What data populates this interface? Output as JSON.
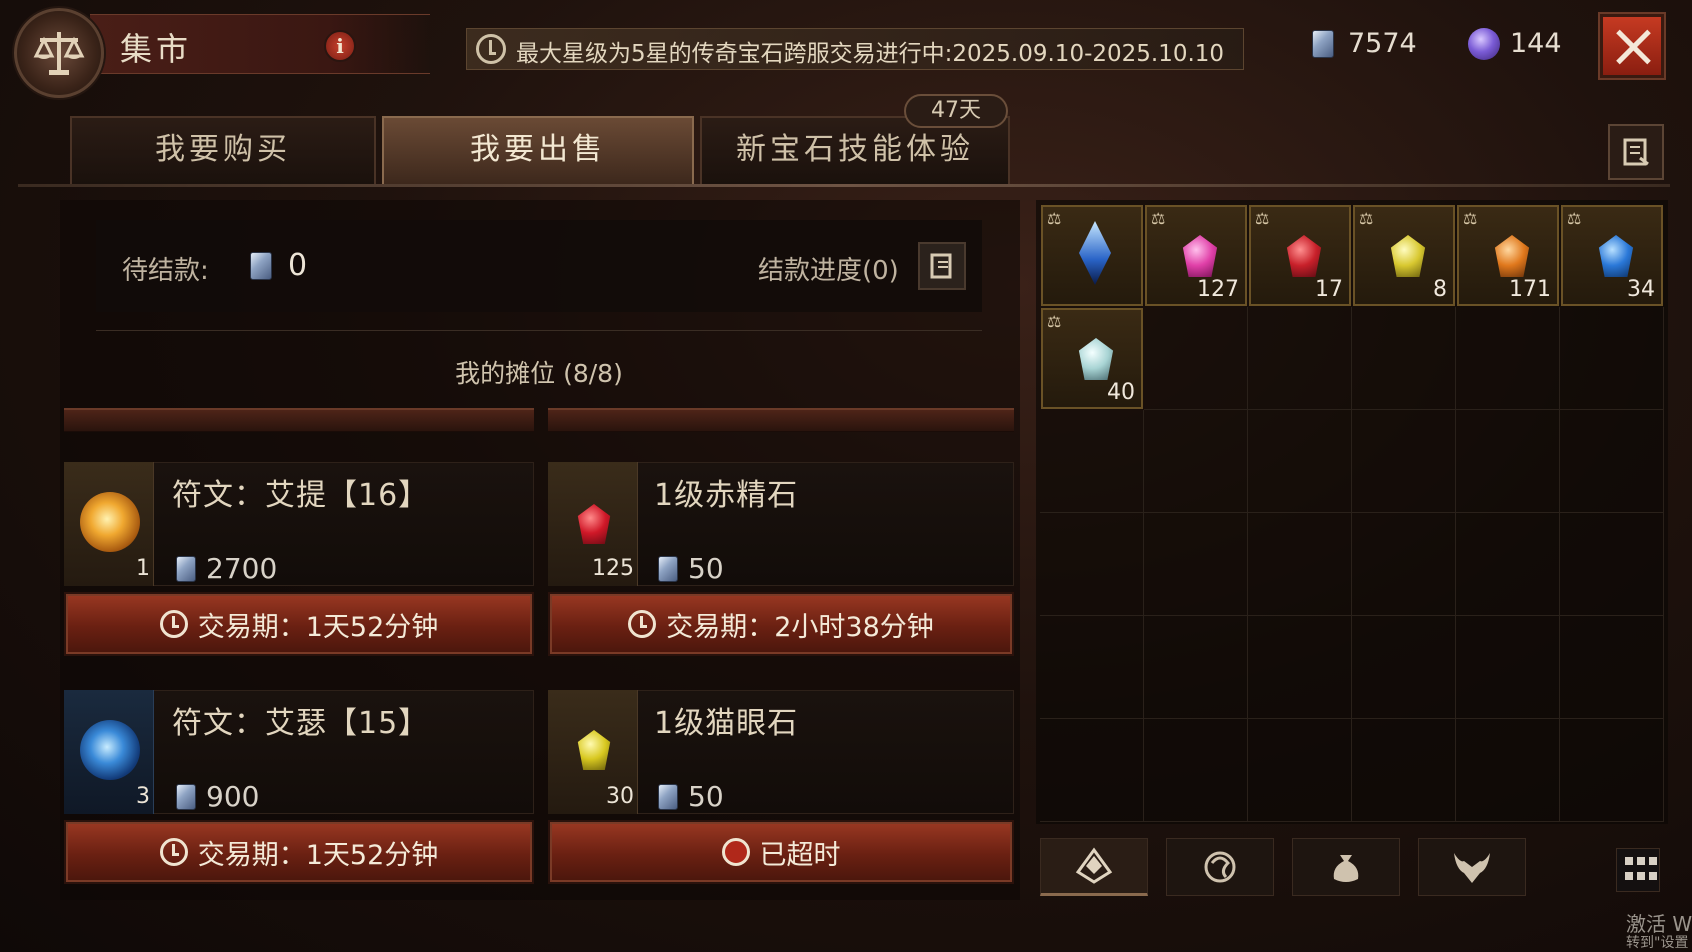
{
  "header": {
    "title": "集市",
    "info_label": "i",
    "notice": "最大星级为5星的传奇宝石跨服交易进行中:2025.09.10-2025.10.10",
    "currency_platinum": "7574",
    "currency_orbs": "144"
  },
  "tabs": {
    "buy": "我要购买",
    "sell": "我要出售",
    "gem_skill": "新宝石技能体验",
    "gem_skill_badge": "47天",
    "active": "sell"
  },
  "sell_panel": {
    "pending_label": "待结款:",
    "pending_value": "0",
    "progress_label": "结款进度(0)",
    "stall_title": "我的摊位 (8/8)"
  },
  "listings": [
    {
      "name": "符文：艾提【16】",
      "count": "1",
      "price": "2700",
      "timer_label": "交易期：1天52分钟",
      "icon": "rune-eth-icon"
    },
    {
      "name": "1级赤精石",
      "count": "125",
      "price": "50",
      "timer_label": "交易期：2小时38分钟",
      "icon": "ruby-gem-icon"
    },
    {
      "name": "符文：艾瑟【15】",
      "count": "3",
      "price": "900",
      "timer_label": "交易期：1天52分钟",
      "icon": "rune-ith-icon"
    },
    {
      "name": "1级猫眼石",
      "count": "30",
      "price": "50",
      "timer_label": "已超时",
      "icon": "topaz-gem-icon"
    }
  ],
  "inventory": [
    {
      "icon": "blue-crystal-icon",
      "qty": "",
      "color": "#2a64c8"
    },
    {
      "icon": "pink-gem-icon",
      "qty": "127",
      "color": "#e040a8"
    },
    {
      "icon": "red-gem-icon",
      "qty": "17",
      "color": "#c8202a"
    },
    {
      "icon": "yellow-gem-icon",
      "qty": "8",
      "color": "#d8c830"
    },
    {
      "icon": "orange-gem-icon",
      "qty": "171",
      "color": "#e0781c"
    },
    {
      "icon": "blue-gem-icon",
      "qty": "34",
      "color": "#2a78d8"
    },
    {
      "icon": "white-gem-icon",
      "qty": "40",
      "color": "#a8d4d4"
    }
  ],
  "watermark": {
    "line1": "激活 W",
    "line2": "转到\"设置"
  }
}
